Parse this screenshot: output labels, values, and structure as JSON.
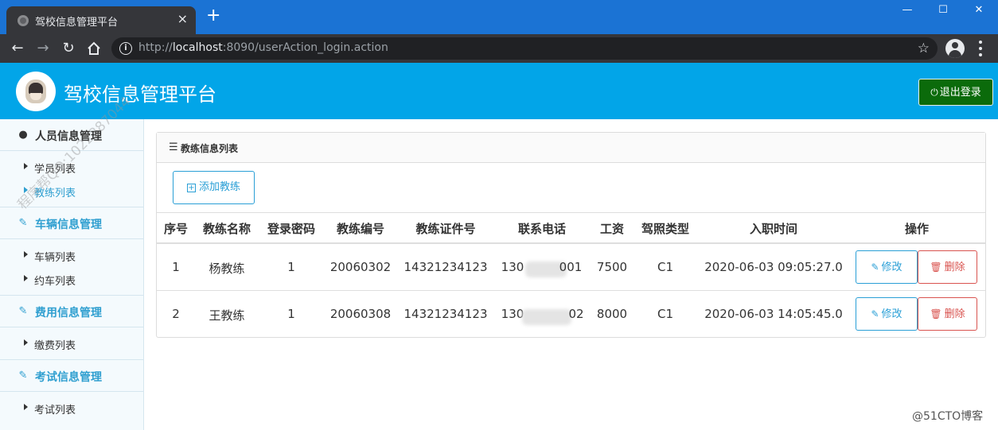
{
  "browser": {
    "tab_title": "驾校信息管理平台",
    "tab_close": "×",
    "new_tab": "+",
    "window_controls": {
      "minimize": "—",
      "maximize": "☐",
      "close": "✕"
    },
    "url_scheme": "http://",
    "url_host": "localhost",
    "url_rest": ":8090/userAction_login.action"
  },
  "header": {
    "title": "驾校信息管理平台",
    "logout_label": "退出登录",
    "logout_color": "#0b6b0b",
    "background_color": "#02a5e8"
  },
  "sidebar": {
    "groups": [
      {
        "label": "人员信息管理",
        "icon": "user-icon",
        "items": [
          {
            "label": "学员列表"
          },
          {
            "label": "教练列表",
            "active": true
          }
        ]
      },
      {
        "label": "车辆信息管理",
        "icon": "edit-icon",
        "items": [
          {
            "label": "车辆列表"
          },
          {
            "label": "约车列表"
          }
        ]
      },
      {
        "label": "费用信息管理",
        "icon": "edit-icon",
        "items": [
          {
            "label": "缴费列表"
          }
        ]
      },
      {
        "label": "考试信息管理",
        "icon": "edit-icon",
        "items": [
          {
            "label": "考试列表"
          }
        ]
      }
    ]
  },
  "panel": {
    "title": "教练信息列表",
    "add_button": "添加教练"
  },
  "table": {
    "headers": [
      "序号",
      "教练名称",
      "登录密码",
      "教练编号",
      "教练证件号",
      "联系电话",
      "工资",
      "驾照类型",
      "入职时间",
      "操作"
    ],
    "rows": [
      {
        "index": "1",
        "name": "杨教练",
        "password": "1",
        "code": "20060302",
        "license_no": "14321234123",
        "phone_start": "130",
        "phone_end": "001",
        "salary": "7500",
        "license_type": "C1",
        "hire_time": "2020-06-03 09:05:27.0"
      },
      {
        "index": "2",
        "name": "王教练",
        "password": "1",
        "code": "20060308",
        "license_no": "14321234123",
        "phone_start": "130",
        "phone_end": "02",
        "salary": "8000",
        "license_type": "C1",
        "hire_time": "2020-06-03 14:05:45.0"
      }
    ],
    "edit_label": "修改",
    "delete_label": "删除"
  },
  "watermark": "程序帮QQ:1022287044",
  "credit": "@51CTO博客"
}
